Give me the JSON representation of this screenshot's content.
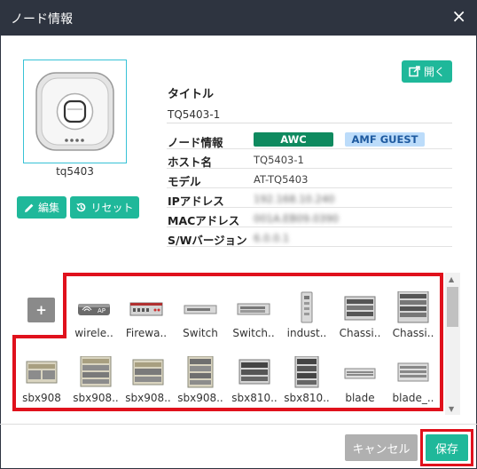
{
  "dialog": {
    "title": "ノード情報",
    "close_glyph": "×"
  },
  "node": {
    "name": "tq5403",
    "icon": "wireless-ap-icon"
  },
  "buttons": {
    "edit": "編集",
    "reset": "リセット",
    "open": "開く",
    "cancel": "キャンセル",
    "save": "保存"
  },
  "info": {
    "title_label": "タイトル",
    "title_value": "TQ5403-1",
    "node_info_label": "ノード情報",
    "badges": [
      "AWC",
      "AMF GUEST"
    ],
    "rows": [
      {
        "label": "ホスト名",
        "value": "TQ5403-1"
      },
      {
        "label": "モデル",
        "value": "AT-TQ5403"
      },
      {
        "label": "IPアドレス",
        "value": "192.168.10.240"
      },
      {
        "label": "MACアドレス",
        "value": "001A.EB09.0390"
      },
      {
        "label": "S/Wバージョン",
        "value": "6.0.0.1"
      }
    ]
  },
  "gallery": {
    "add_label": "+",
    "row1": [
      "wirele..",
      "Firewa..",
      "Switch",
      "Switch..",
      "indust..",
      "Chassi..",
      "Chassi.."
    ],
    "row2": [
      "sbx908",
      "sbx908..",
      "sbx908..",
      "sbx908..",
      "sbx810..",
      "sbx810..",
      "blade",
      "blade_.."
    ]
  },
  "colors": {
    "titlebar": "#2e3440",
    "accent": "#1fb89a",
    "awc_badge": "#0f8a5f",
    "amf_badge": "#bcdcfa",
    "highlight": "#e0111c"
  }
}
